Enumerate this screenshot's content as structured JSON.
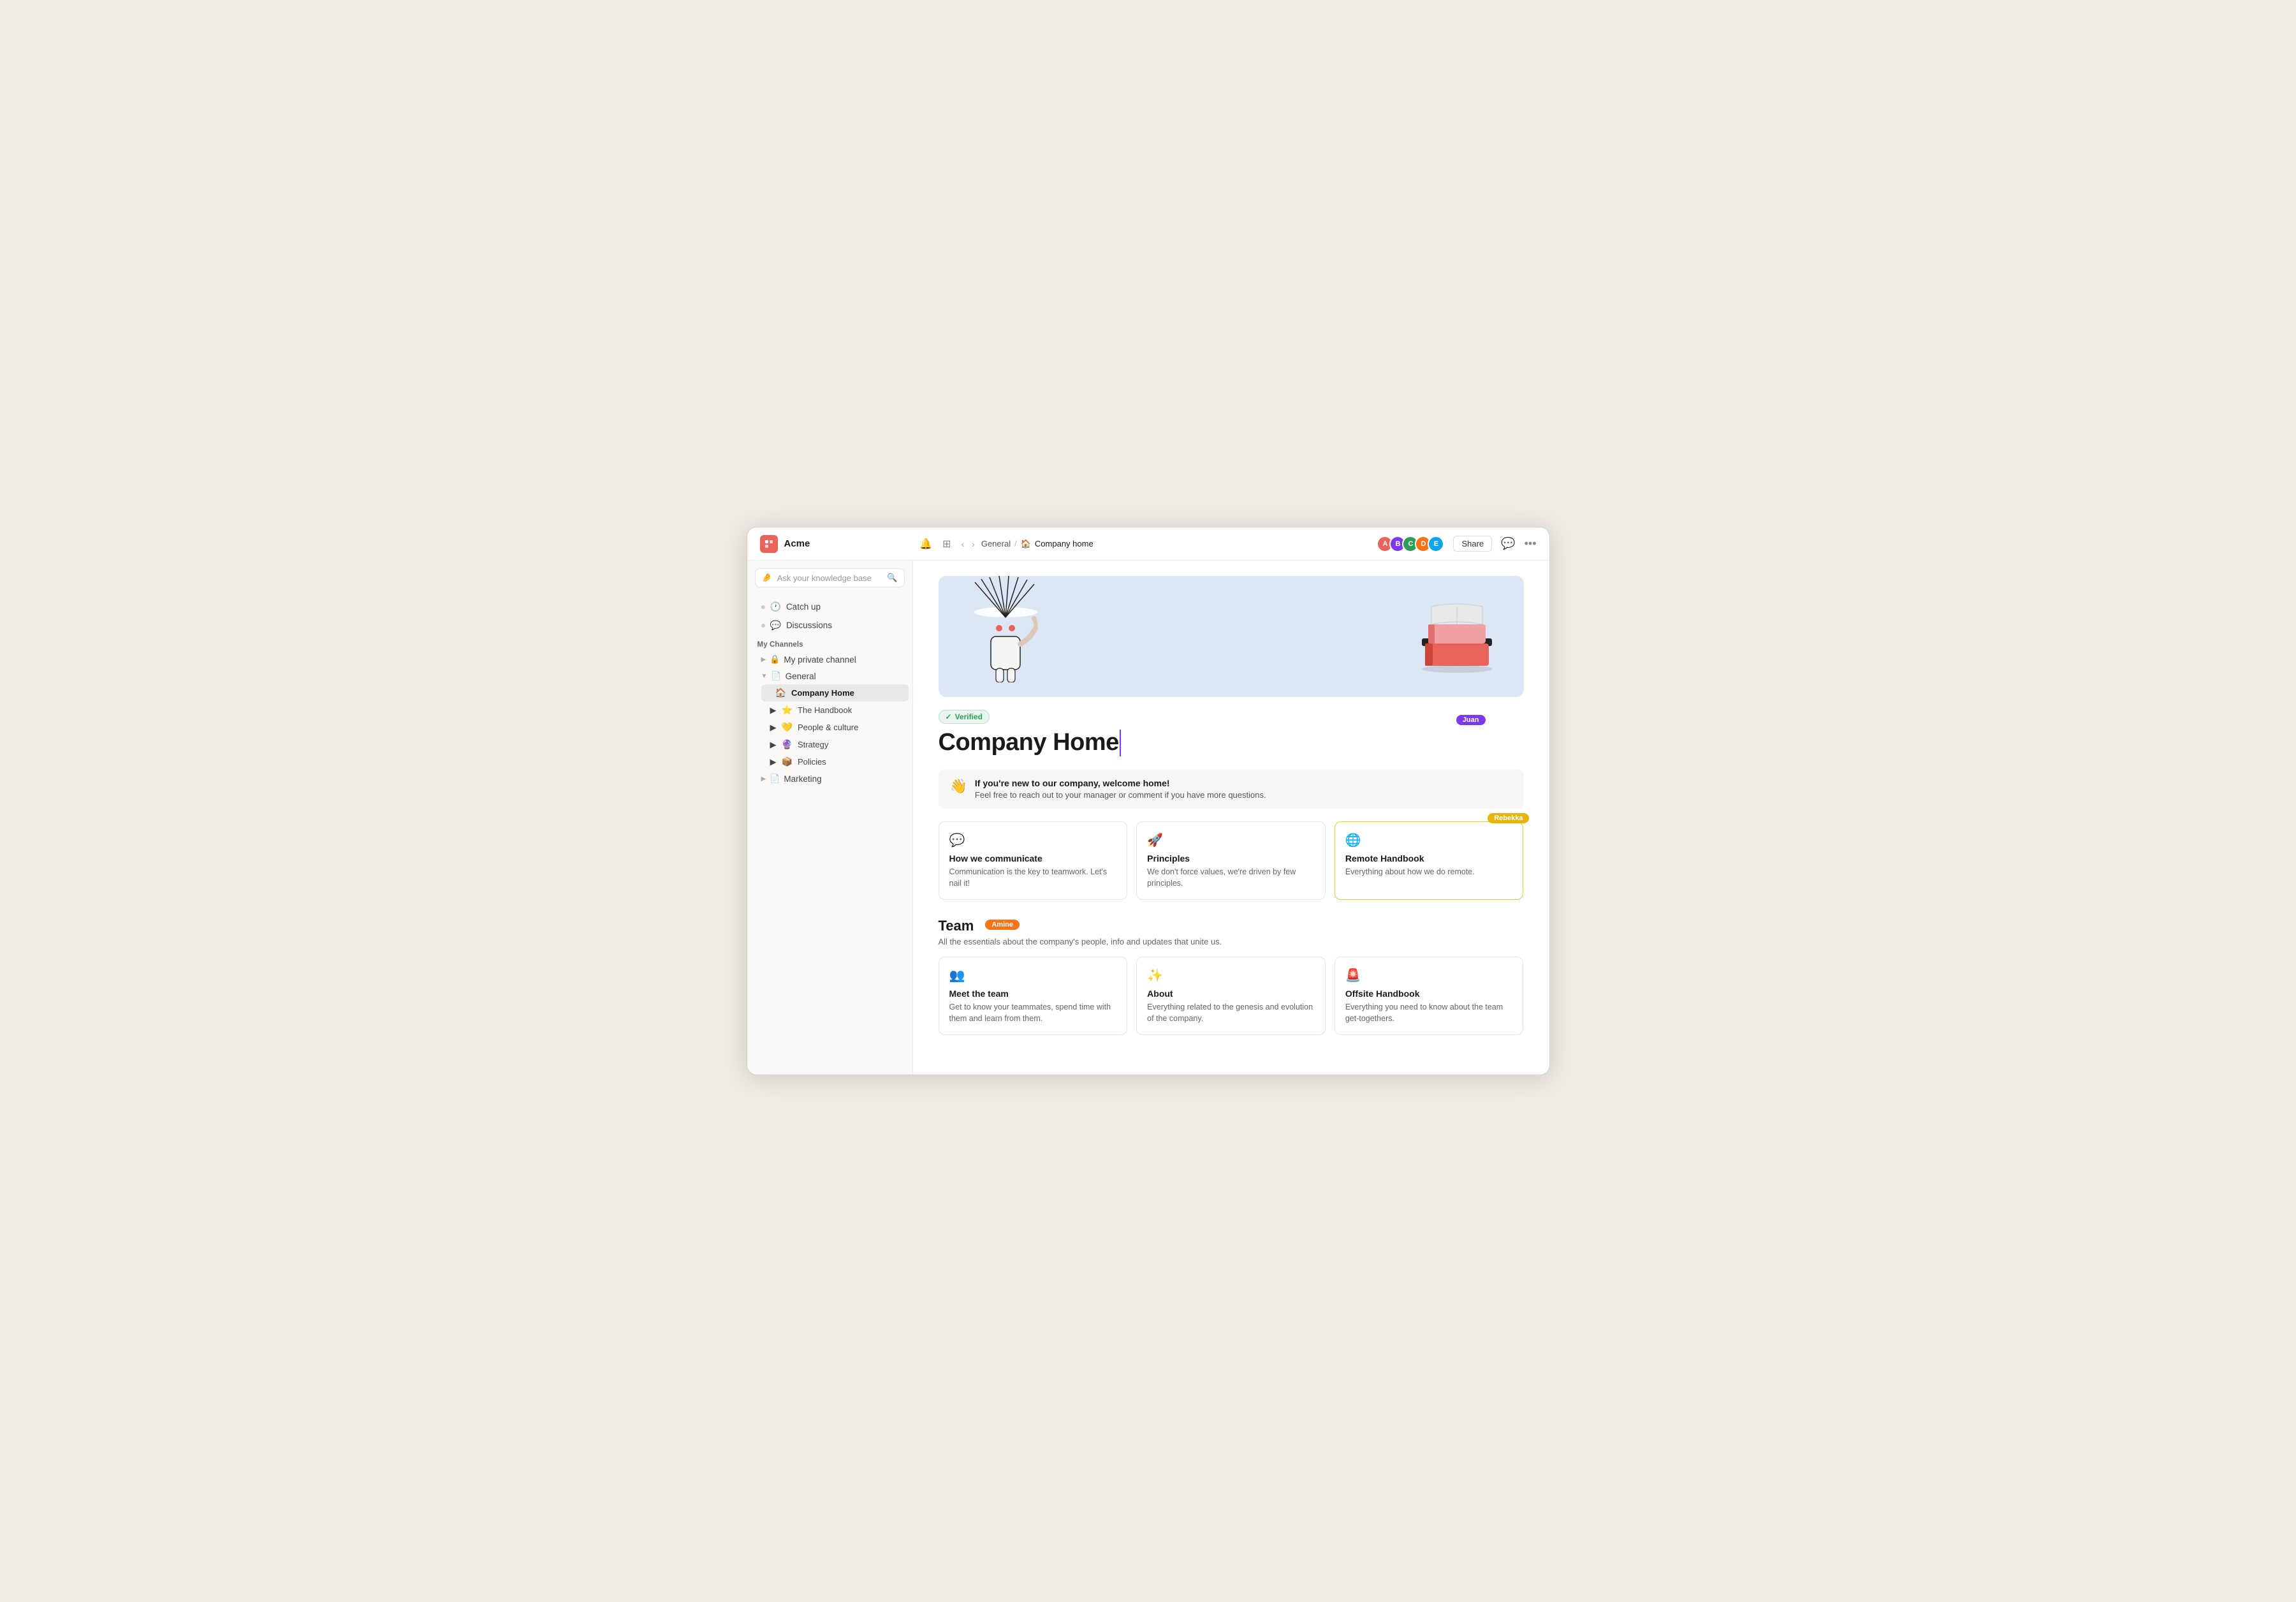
{
  "app": {
    "name": "Acme"
  },
  "header": {
    "back_arrow": "‹",
    "forward_arrow": "›",
    "breadcrumb": [
      "General",
      "Company home"
    ],
    "breadcrumb_icon": "🏠",
    "share_label": "Share",
    "avatars": [
      {
        "initials": "A",
        "color": "#e8645a"
      },
      {
        "initials": "B",
        "color": "#7c3aed"
      },
      {
        "initials": "C",
        "color": "#2e9e5b"
      },
      {
        "initials": "D",
        "color": "#f97316"
      },
      {
        "initials": "E",
        "color": "#0ea5e9"
      }
    ]
  },
  "sidebar": {
    "search_placeholder": "Ask your knowledge base",
    "top_items": [
      {
        "label": "Catch up",
        "icon": "🕐"
      },
      {
        "label": "Discussions",
        "icon": "💬"
      }
    ],
    "section_title": "My Channels",
    "channels": [
      {
        "label": "My private channel",
        "icon": "🔒",
        "expanded": false
      },
      {
        "label": "General",
        "icon": "📄",
        "expanded": true,
        "children": [
          {
            "label": "Company Home",
            "icon": "🏠",
            "active": true
          },
          {
            "label": "The Handbook",
            "icon": "⭐"
          },
          {
            "label": "People & culture",
            "icon": "💛"
          },
          {
            "label": "Strategy",
            "icon": "🔮"
          },
          {
            "label": "Policies",
            "icon": "📦"
          }
        ]
      },
      {
        "label": "Marketing",
        "icon": "📄",
        "expanded": false
      }
    ]
  },
  "main": {
    "verified_label": "Verified",
    "page_title": "Company Home",
    "cursor_user": "Juan",
    "welcome": {
      "title": "If you're new to our company, welcome home!",
      "subtitle": "Feel free to reach out to your manager or comment if you have more questions."
    },
    "cards_section1": {
      "cards": [
        {
          "icon": "💬",
          "title": "How we communicate",
          "desc": "Communication is the key to teamwork. Let's nail it!"
        },
        {
          "icon": "🚀",
          "title": "Principles",
          "desc": "We don't force values, we're driven by few principles."
        },
        {
          "icon": "🌐",
          "title": "Remote Handbook",
          "desc": "Everything about how we do remote.",
          "highlighted": true,
          "cursor_user": "Rebekka"
        }
      ]
    },
    "team_section": {
      "title": "Team",
      "cursor_user": "Amine",
      "desc": "All the essentials about the company's people, info and updates that unite us.",
      "cards": [
        {
          "icon": "👥",
          "title": "Meet the team",
          "desc": "Get to know your teammates, spend time with them and learn from them."
        },
        {
          "icon": "✨",
          "title": "About",
          "desc": "Everything related to the genesis and evolution of the company."
        },
        {
          "icon": "🚨",
          "title": "Offsite Handbook",
          "desc": "Everything you need to know about the team get-togethers."
        }
      ]
    }
  }
}
